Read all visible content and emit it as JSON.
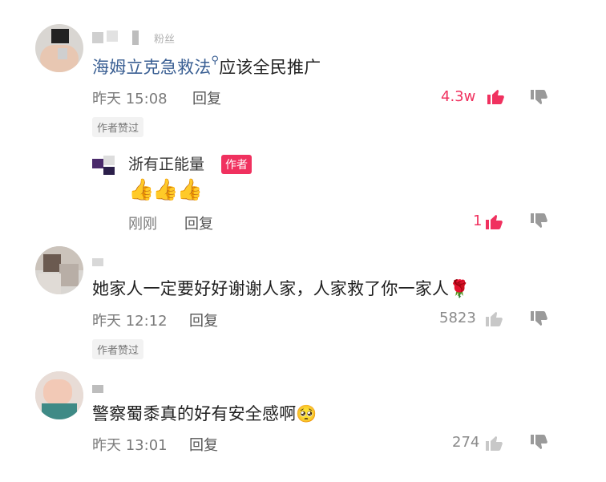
{
  "comments": [
    {
      "user": "粉丝",
      "text_link": "海姆立克急救法",
      "text_rest": "应该全民推广",
      "time": "昨天 15:08",
      "reply": "回复",
      "likes": "4.3w",
      "liked_badge": "作者赞过",
      "reply_item": {
        "user": "浙有正能量",
        "badge": "作者",
        "emoji": "👍👍👍",
        "time": "刚刚",
        "reply": "回复",
        "likes": "1"
      }
    },
    {
      "text": "她家人一定要好好谢谢人家，人家救了你一家人🌹",
      "time": "昨天 12:12",
      "reply": "回复",
      "likes": "5823",
      "liked_badge": "作者赞过"
    },
    {
      "text": "警察蜀黍真的好有安全感啊🥺",
      "time": "昨天 13:01",
      "reply": "回复",
      "likes": "274"
    }
  ],
  "colors": {
    "accent": "#f0315f",
    "link": "#3a5f93",
    "meta": "#7a7a7a"
  },
  "icons": [
    "thumbs-up-icon",
    "thumbs-down-icon",
    "search-icon"
  ]
}
